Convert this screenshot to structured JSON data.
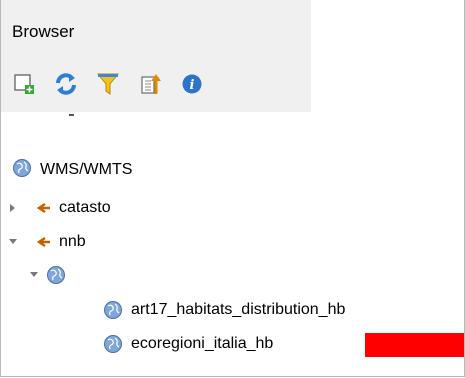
{
  "panel": {
    "title": "Browser",
    "toolbar": [
      {
        "name": "add-selected-layers-icon"
      },
      {
        "name": "refresh-icon"
      },
      {
        "name": "filter-icon"
      },
      {
        "name": "collapse-all-icon"
      },
      {
        "name": "info-icon"
      }
    ]
  },
  "tree": {
    "root": {
      "label": "WMS/WMTS",
      "icon": "globe-icon"
    },
    "connections": [
      {
        "label": "catasto",
        "expanded": false,
        "icon": "wms-connection-icon"
      },
      {
        "label": "nnb",
        "expanded": true,
        "icon": "wms-connection-icon"
      }
    ],
    "group_icon": "globe-icon",
    "layers": [
      {
        "label": "art17_habitats_distribution_hb",
        "icon": "globe-icon"
      },
      {
        "label": "ecoregioni_italia_hb",
        "icon": "globe-icon"
      }
    ]
  },
  "colors": {
    "header_bg": "#f0f0f0",
    "redaction": "#ff0000",
    "connection_icon": "#c56200"
  }
}
